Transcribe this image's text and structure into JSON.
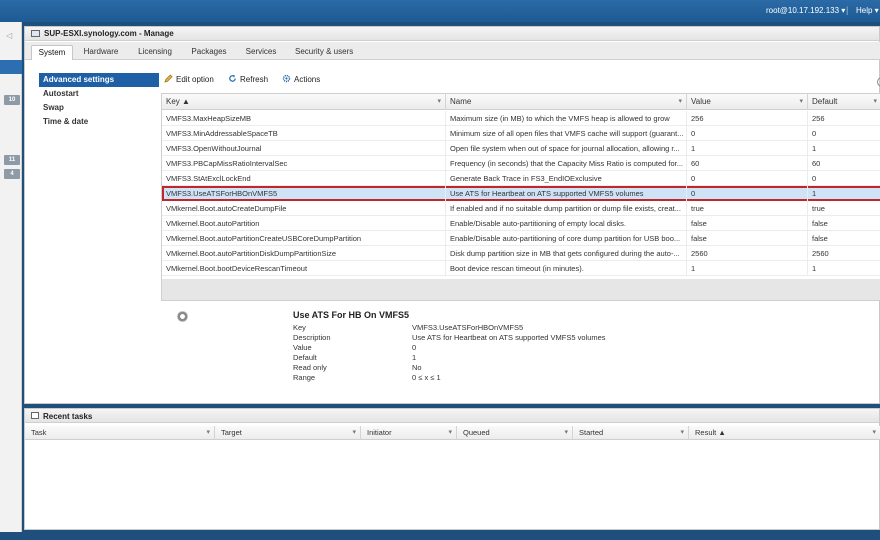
{
  "topbar": {
    "user": "root@10.17.192.133 ▾",
    "separator": "|",
    "help": "Help ▾"
  },
  "leftnav": {
    "collapse_glyph": "◁",
    "badges": [
      "10",
      "11",
      "4"
    ]
  },
  "window": {
    "title": "SUP-ESXI.synology.com - Manage",
    "tabs": [
      "System",
      "Hardware",
      "Licensing",
      "Packages",
      "Services",
      "Security & users"
    ],
    "active_tab": "System"
  },
  "sidebar": {
    "items": [
      "Advanced settings",
      "Autostart",
      "Swap",
      "Time & date"
    ]
  },
  "toolbar": {
    "edit": "Edit option",
    "refresh": "Refresh",
    "actions": "Actions"
  },
  "grid": {
    "headers": [
      "Key ▲",
      "Name",
      "Value",
      "Default"
    ],
    "rows": [
      [
        "VMFS3.MaxHeapSizeMB",
        "Maximum size (in MB) to which the VMFS heap is allowed to grow",
        "256",
        "256"
      ],
      [
        "VMFS3.MinAddressableSpaceTB",
        "Minimum size of all open files that VMFS cache will support (guarant...",
        "0",
        "0"
      ],
      [
        "VMFS3.OpenWithoutJournal",
        "Open file system when out of space for journal allocation, allowing r...",
        "1",
        "1"
      ],
      [
        "VMFS3.PBCapMissRatioIntervalSec",
        "Frequency (in seconds) that the Capacity Miss Ratio is computed for...",
        "60",
        "60"
      ],
      [
        "VMFS3.StAtExclLockEnd",
        "Generate Back Trace in FS3_EndIOExclusive",
        "0",
        "0"
      ],
      [
        "VMFS3.UseATSForHBOnVMFS5",
        "Use ATS for Heartbeat on ATS supported VMFS5 volumes",
        "0",
        "1"
      ],
      [
        "VMkernel.Boot.autoCreateDumpFile",
        "If enabled and if no suitable dump partition or dump file exists, creat...",
        "true",
        "true"
      ],
      [
        "VMkernel.Boot.autoPartition",
        "Enable/Disable auto-partitioning of empty local disks.",
        "false",
        "false"
      ],
      [
        "VMkernel.Boot.autoPartitionCreateUSBCoreDumpPartition",
        "Enable/Disable auto-partitioning of core dump partition for USB boo...",
        "false",
        "false"
      ],
      [
        "VMkernel.Boot.autoPartitionDiskDumpPartitionSize",
        "Disk dump partition size in MB that gets configured during the auto-...",
        "2560",
        "2560"
      ],
      [
        "VMkernel.Boot.bootDeviceRescanTimeout",
        "Boot device rescan timeout (in minutes).",
        "1",
        "1"
      ]
    ],
    "selected_row": 5
  },
  "details": {
    "title": "Use ATS For HB On VMFS5",
    "fields": [
      {
        "label": "Key",
        "value": "VMFS3.UseATSForHBOnVMFS5"
      },
      {
        "label": "Description",
        "value": "Use ATS for Heartbeat on ATS supported VMFS5 volumes"
      },
      {
        "label": "Value",
        "value": "0"
      },
      {
        "label": "Default",
        "value": "1"
      },
      {
        "label": "Read only",
        "value": "No"
      },
      {
        "label": "Range",
        "value": "0 ≤ x ≤ 1"
      }
    ]
  },
  "tasks": {
    "title": "Recent tasks",
    "headers": [
      "Task",
      "Target",
      "Initiator",
      "Queued",
      "Started",
      "Result ▲"
    ]
  },
  "colors": {
    "accent": "#1f5fa6",
    "selection_outline": "#c0272d",
    "selection_fill": "#cfe3f7"
  }
}
